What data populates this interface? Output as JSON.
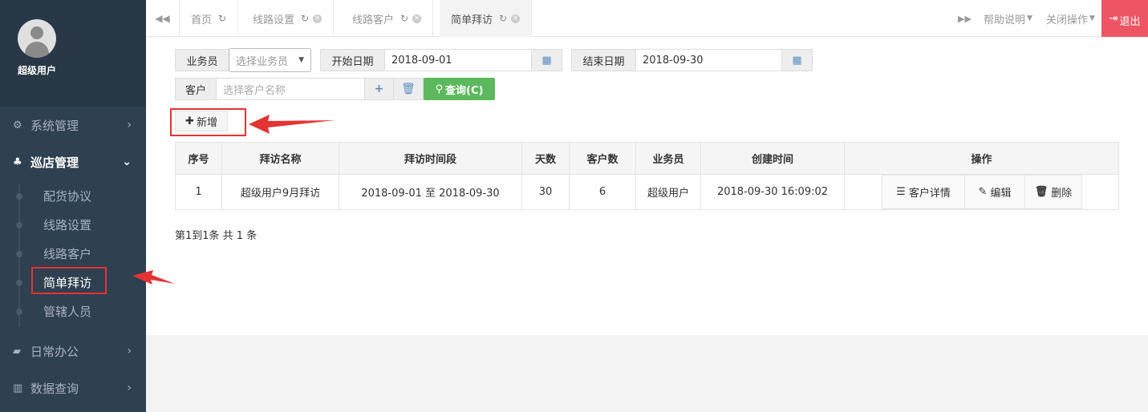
{
  "sidebar": {
    "user_name": "超级用户",
    "menu": [
      {
        "label": "系统管理",
        "icon": "gears-icon"
      },
      {
        "label": "巡店管理",
        "icon": "sitemap-icon"
      },
      {
        "label": "日常办公",
        "icon": "briefcase-icon"
      },
      {
        "label": "数据查询",
        "icon": "bar-chart-icon"
      }
    ],
    "sub_items": [
      "配货协议",
      "线路设置",
      "线路客户",
      "简单拜访",
      "管辖人员"
    ]
  },
  "tabs": [
    {
      "label": "首页"
    },
    {
      "label": "线路设置"
    },
    {
      "label": "线路客户"
    },
    {
      "label": "简单拜访"
    }
  ],
  "topbar": {
    "help": "帮助说明",
    "close_ops": "关闭操作",
    "logout": "退出"
  },
  "filters": {
    "salesman_label": "业务员",
    "salesman_placeholder": "选择业务员",
    "start_label": "开始日期",
    "start_value": "2018-09-01",
    "end_label": "结束日期",
    "end_value": "2018-09-30",
    "customer_label": "客户",
    "customer_placeholder": "选择客户名称",
    "query_button": "查询(C)",
    "add_button": "新增"
  },
  "table": {
    "headers": [
      "序号",
      "拜访名称",
      "拜访时间段",
      "天数",
      "客户数",
      "业务员",
      "创建时间",
      "操作"
    ],
    "rows": [
      {
        "index": "1",
        "name": "超级用户9月拜访",
        "period": "2018-09-01 至 2018-09-30",
        "days": "30",
        "customers": "6",
        "salesman": "超级用户",
        "created": "2018-09-30 16:09:02"
      }
    ],
    "actions": {
      "detail": "客户详情",
      "edit": "编辑",
      "delete": "删除"
    }
  },
  "pagination": "第1到1条 共 1 条",
  "colors": {
    "sidebar": "#2f4050",
    "accent_green": "#5cb85c",
    "logout_red": "#ed5565",
    "highlight_red": "#e53333"
  }
}
